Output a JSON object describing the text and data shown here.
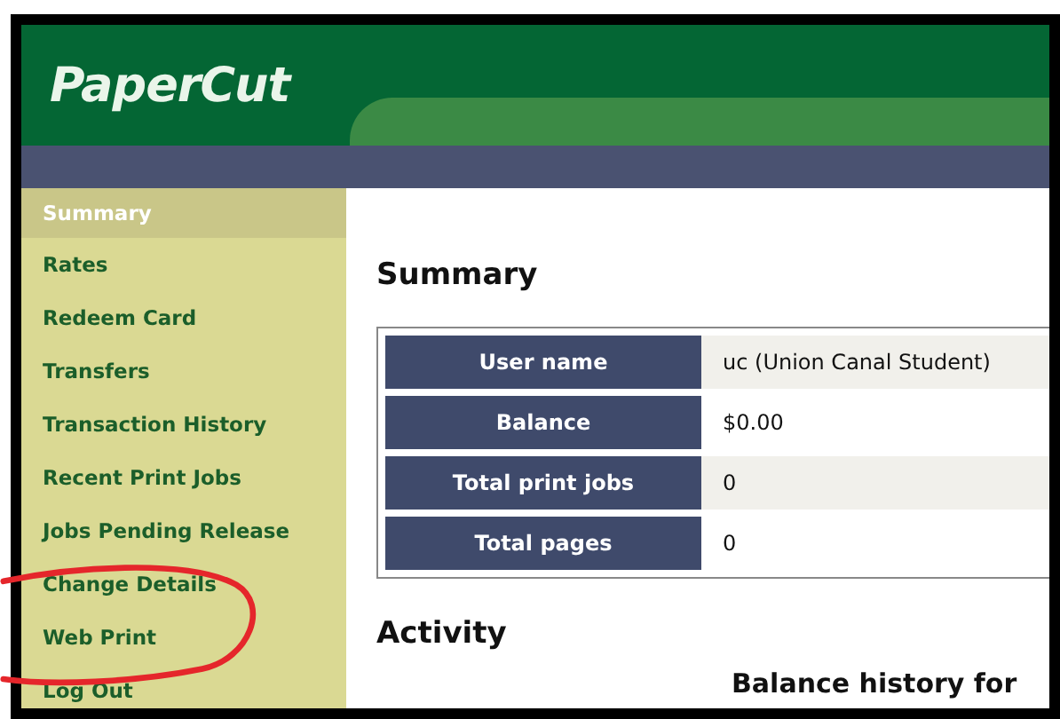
{
  "logo": "PaperCut",
  "sidebar": {
    "items": [
      {
        "label": "Summary",
        "selected": true
      },
      {
        "label": "Rates",
        "selected": false
      },
      {
        "label": "Redeem Card",
        "selected": false
      },
      {
        "label": "Transfers",
        "selected": false
      },
      {
        "label": "Transaction History",
        "selected": false
      },
      {
        "label": "Recent Print Jobs",
        "selected": false
      },
      {
        "label": "Jobs Pending Release",
        "selected": false
      },
      {
        "label": "Change Details",
        "selected": false
      },
      {
        "label": "Web Print",
        "selected": false
      },
      {
        "label": "Log Out",
        "selected": false
      }
    ]
  },
  "main": {
    "heading": "Summary",
    "summary_table": {
      "rows": [
        {
          "label": "User name",
          "value": "uc (Union Canal Student)"
        },
        {
          "label": "Balance",
          "value": "$0.00"
        },
        {
          "label": "Total print jobs",
          "value": "0"
        },
        {
          "label": "Total pages",
          "value": "0"
        }
      ]
    },
    "activity": {
      "heading": "Activity",
      "subheading": "Balance history for"
    }
  }
}
